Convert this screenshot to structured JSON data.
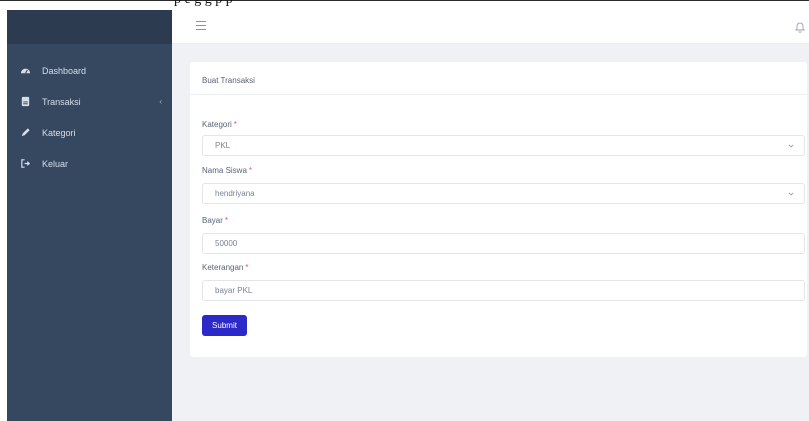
{
  "top_partial_text": "p             e       g       g     p       p",
  "sidebar": {
    "items": [
      {
        "label": "Dashboard",
        "icon": "dashboard-icon"
      },
      {
        "label": "Transaksi",
        "icon": "document-icon",
        "chevron": "‹"
      },
      {
        "label": "Kategori",
        "icon": "pencil-icon"
      },
      {
        "label": "Keluar",
        "icon": "sign-out-icon"
      }
    ]
  },
  "header": {
    "menu_icon": "hamburger-icon",
    "bell_icon": "bell-icon"
  },
  "form": {
    "title": "Buat Transaksi",
    "required_mark": "*",
    "kategori": {
      "label": "Kategori",
      "value": "PKL"
    },
    "nama_siswa": {
      "label": "Nama Siswa",
      "value": "hendriyana"
    },
    "bayar": {
      "label": "Bayar",
      "value": "50000"
    },
    "keterangan": {
      "label": "Keterangan",
      "value": "bayar PKL"
    },
    "submit_label": "Submit"
  },
  "colors": {
    "sidebar": "#364860",
    "sidebar_brand": "#2c3b50",
    "accent": "#2d28c8",
    "required": "#e3506c",
    "background": "#f0f1f4"
  }
}
